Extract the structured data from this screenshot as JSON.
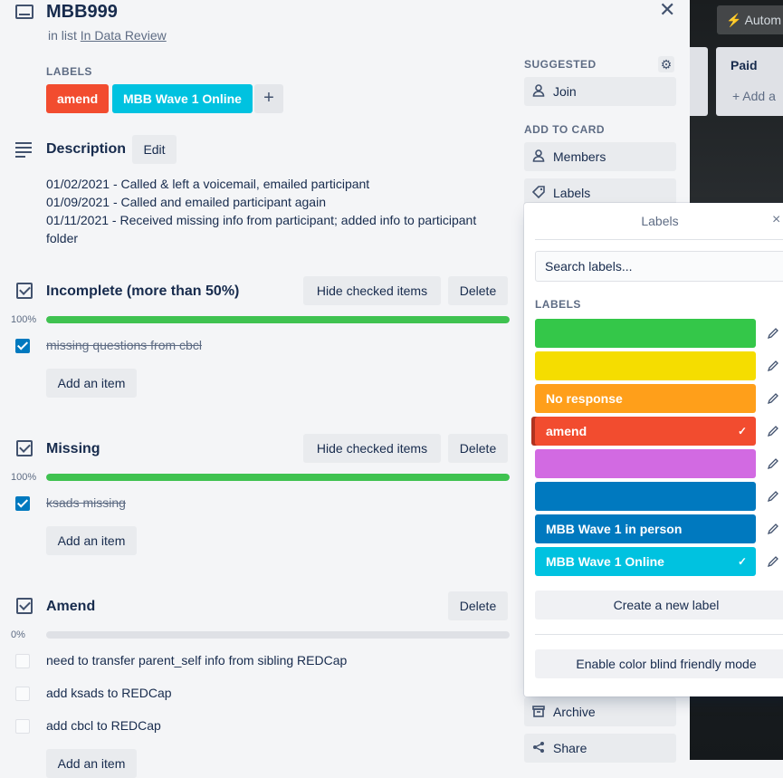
{
  "card": {
    "title": "MBB999",
    "in_list_prefix": "in list",
    "list_name": "In Data Review"
  },
  "labels_section": {
    "heading": "LABELS",
    "chips": [
      {
        "text": "amend",
        "color": "#f24c2f"
      },
      {
        "text": "MBB Wave 1 Online",
        "color": "#00c2e0"
      }
    ],
    "add": "+"
  },
  "description": {
    "heading": "Description",
    "edit": "Edit",
    "lines": [
      "01/02/2021 - Called & left a voicemail, emailed participant",
      "01/09/2021 - Called and emailed participant again",
      "01/11/2021 - Received missing info from participant; added info to participant folder"
    ]
  },
  "checklists": [
    {
      "title": "Incomplete (more than 50%)",
      "hide_checked": "Hide checked items",
      "delete": "Delete",
      "percent_label": "100%",
      "progress": 1.0,
      "items": [
        {
          "text": "missing questions from cbcl",
          "checked": true
        }
      ],
      "add_item": "Add an item"
    },
    {
      "title": "Missing",
      "hide_checked": "Hide checked items",
      "delete": "Delete",
      "percent_label": "100%",
      "progress": 1.0,
      "items": [
        {
          "text": "ksads missing",
          "checked": true
        }
      ],
      "add_item": "Add an item"
    },
    {
      "title": "Amend",
      "delete": "Delete",
      "percent_label": "0%",
      "progress": 0,
      "items": [
        {
          "text": "need to transfer parent_self info from sibling REDCap",
          "checked": false
        },
        {
          "text": "add ksads to REDCap",
          "checked": false
        },
        {
          "text": "add cbcl to REDCap",
          "checked": false
        }
      ],
      "add_item": "Add an item"
    }
  ],
  "sidebar": {
    "suggested": "SUGGESTED",
    "join": "Join",
    "add_to_card": "ADD TO CARD",
    "members": "Members",
    "labels": "Labels",
    "archive": "Archive",
    "share": "Share"
  },
  "background": {
    "automate": "Autom",
    "list_title": "Paid",
    "list_add": "+ Add a"
  },
  "popover": {
    "title": "Labels",
    "close": "×",
    "search_placeholder": "Search labels...",
    "section": "LABELS",
    "labels": [
      {
        "text": "",
        "color": "#34c749",
        "selected": false
      },
      {
        "text": "",
        "color": "#f5dd00",
        "selected": false
      },
      {
        "text": "No response",
        "color": "#ff9f1a",
        "selected": false
      },
      {
        "text": "amend",
        "color": "#f24c2f",
        "selected": true
      },
      {
        "text": "",
        "color": "#d26ae2",
        "selected": false
      },
      {
        "text": "",
        "color": "#0079bf",
        "selected": false
      },
      {
        "text": "MBB Wave 1 in person",
        "color": "#0079bf",
        "selected": false
      },
      {
        "text": "MBB Wave 1 Online",
        "color": "#00c2e0",
        "selected": true
      }
    ],
    "create_label": "Create a new label",
    "color_blind": "Enable color blind friendly mode"
  }
}
